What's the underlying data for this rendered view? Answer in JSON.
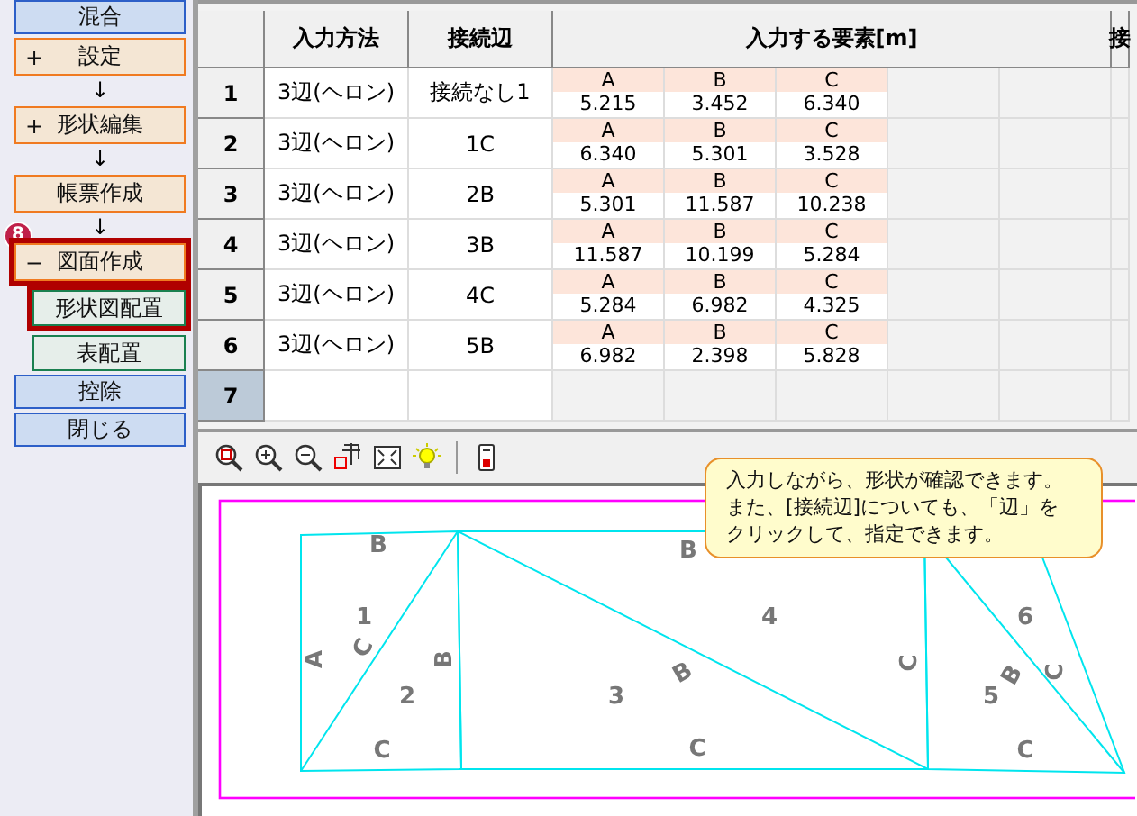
{
  "sidebar": {
    "items": [
      {
        "kind": "button",
        "label": "混合"
      },
      {
        "kind": "step",
        "prefix": "+",
        "label": "設定",
        "highlighted": false
      },
      {
        "kind": "arrow",
        "label": "↓"
      },
      {
        "kind": "step",
        "prefix": "+",
        "label": "形状編集",
        "highlighted": false
      },
      {
        "kind": "arrow",
        "label": "↓"
      },
      {
        "kind": "step",
        "label": "帳票作成",
        "highlighted": false
      },
      {
        "kind": "arrow",
        "label": "↓"
      },
      {
        "kind": "step",
        "prefix": "−",
        "label": "図面作成",
        "highlighted": true,
        "badge": "8"
      },
      {
        "kind": "sub",
        "label": "形状図配置",
        "highlighted": true
      },
      {
        "kind": "sub",
        "label": "表配置",
        "highlighted": false
      },
      {
        "kind": "button",
        "label": "控除"
      },
      {
        "kind": "button",
        "label": "閉じる"
      }
    ]
  },
  "table": {
    "columns": [
      "入力方法",
      "接続辺",
      "入力する要素[m]",
      "接"
    ],
    "rows": [
      {
        "number": "1",
        "selected": false,
        "method": "3辺(ヘロン)",
        "edge": "接続なし1",
        "elements": [
          {
            "name": "A",
            "value": "5.215"
          },
          {
            "name": "B",
            "value": "3.452"
          },
          {
            "name": "C",
            "value": "6.340"
          }
        ]
      },
      {
        "number": "2",
        "selected": false,
        "method": "3辺(ヘロン)",
        "edge": "1C",
        "elements": [
          {
            "name": "A",
            "value": "6.340"
          },
          {
            "name": "B",
            "value": "5.301"
          },
          {
            "name": "C",
            "value": "3.528"
          }
        ]
      },
      {
        "number": "3",
        "selected": false,
        "method": "3辺(ヘロン)",
        "edge": "2B",
        "elements": [
          {
            "name": "A",
            "value": "5.301"
          },
          {
            "name": "B",
            "value": "11.587"
          },
          {
            "name": "C",
            "value": "10.238"
          }
        ]
      },
      {
        "number": "4",
        "selected": false,
        "method": "3辺(ヘロン)",
        "edge": "3B",
        "elements": [
          {
            "name": "A",
            "value": "11.587"
          },
          {
            "name": "B",
            "value": "10.199"
          },
          {
            "name": "C",
            "value": "5.284"
          }
        ]
      },
      {
        "number": "5",
        "selected": false,
        "method": "3辺(ヘロン)",
        "edge": "4C",
        "elements": [
          {
            "name": "A",
            "value": "5.284"
          },
          {
            "name": "B",
            "value": "6.982"
          },
          {
            "name": "C",
            "value": "4.325"
          }
        ]
      },
      {
        "number": "6",
        "selected": false,
        "method": "3辺(ヘロン)",
        "edge": "5B",
        "elements": [
          {
            "name": "A",
            "value": "6.982"
          },
          {
            "name": "B",
            "value": "2.398"
          },
          {
            "name": "C",
            "value": "5.828"
          }
        ]
      },
      {
        "number": "7",
        "selected": true
      }
    ]
  },
  "drawing": {
    "labels": [
      "B",
      "1",
      "A",
      "C",
      "B",
      "2",
      "C",
      "B",
      "4",
      "B",
      "3",
      "C",
      "C",
      "6",
      "B",
      "C",
      "5",
      "C"
    ]
  },
  "tooltip": {
    "lines": [
      "入力しながら、形状が確認できます。",
      "また、[接続辺]についても、「辺」を",
      "クリックして、指定できます。"
    ]
  }
}
